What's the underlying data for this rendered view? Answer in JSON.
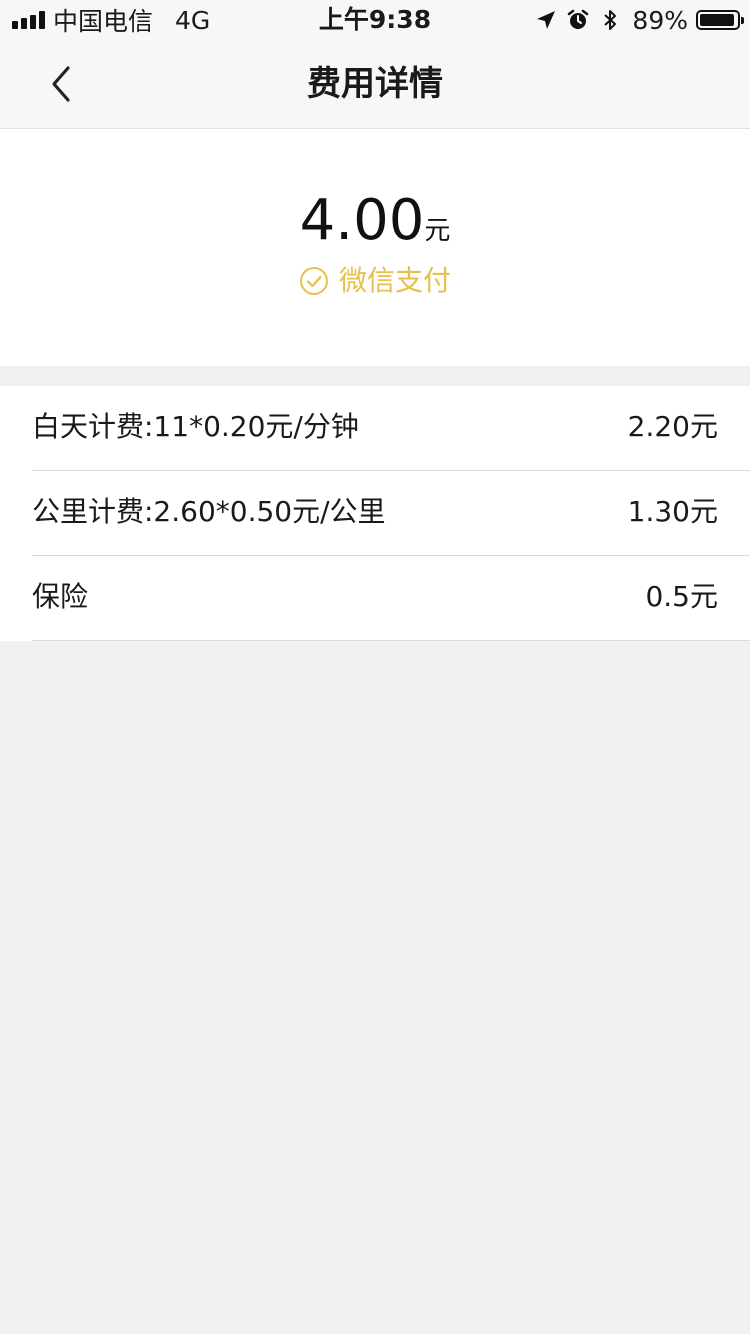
{
  "status_bar": {
    "carrier": "中国电信",
    "network": "4G",
    "time": "上午9:38",
    "battery_percent": "89%",
    "icons": [
      "signal-icon",
      "location-arrow-icon",
      "alarm-icon",
      "bluetooth-icon",
      "battery-icon"
    ]
  },
  "header": {
    "title": "费用详情",
    "back_icon": "chevron-left-icon"
  },
  "summary": {
    "amount": "4.00",
    "unit": "元",
    "payment_method": "微信支付",
    "payment_icon": "check-circle-icon",
    "accent_color": "#e8bf4c"
  },
  "details": [
    {
      "label": "白天计费:11*0.20元/分钟",
      "value": "2.20元"
    },
    {
      "label": "公里计费:2.60*0.50元/公里",
      "value": "1.30元"
    },
    {
      "label": "保险",
      "value": "0.5元"
    }
  ]
}
